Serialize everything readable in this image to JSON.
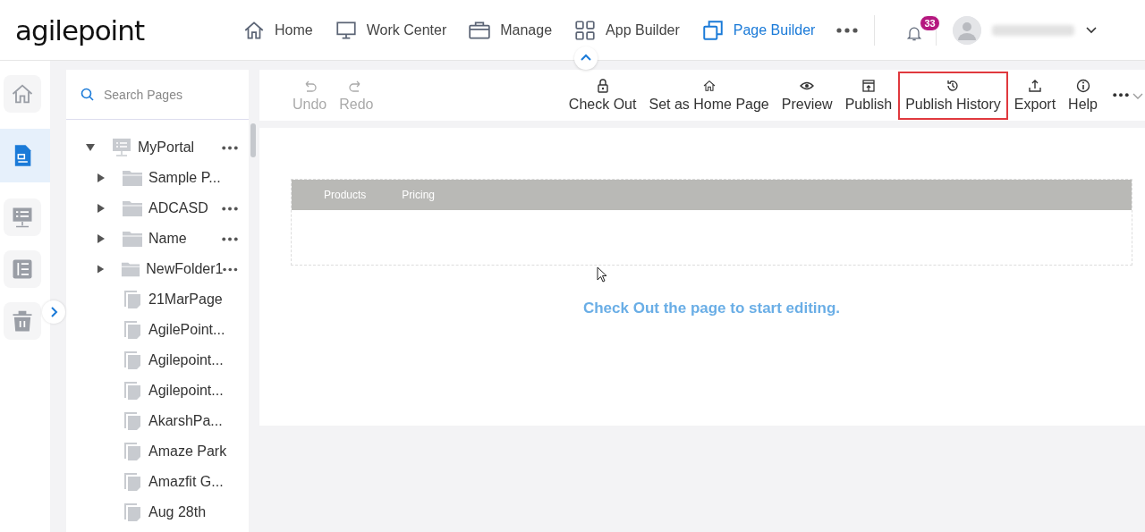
{
  "header": {
    "logo": "agilepoint",
    "nav": [
      {
        "label": "Home",
        "selected": false
      },
      {
        "label": "Work Center",
        "selected": false
      },
      {
        "label": "Manage",
        "selected": false
      },
      {
        "label": "App Builder",
        "selected": false
      },
      {
        "label": "Page Builder",
        "selected": true
      }
    ],
    "notifications": "33"
  },
  "rail": [
    {
      "selected": false
    },
    {
      "selected": true
    },
    {
      "selected": false
    },
    {
      "selected": false
    },
    {
      "selected": false
    }
  ],
  "tree": {
    "search": {
      "placeholder": "Search Pages"
    },
    "items": [
      {
        "label": "MyPortal",
        "kind": "portal",
        "expanded": true,
        "has_menu": true,
        "children": [
          {
            "label": "Sample P...",
            "kind": "folder",
            "expanded": false,
            "has_menu": false
          },
          {
            "label": "ADCASD",
            "kind": "folder",
            "expanded": false,
            "has_menu": true
          },
          {
            "label": "Name",
            "kind": "folder",
            "expanded": false,
            "has_menu": true
          },
          {
            "label": "NewFolder1",
            "kind": "folder",
            "expanded": false,
            "has_menu": true
          },
          {
            "label": "21MarPage",
            "kind": "page",
            "has_menu": false
          },
          {
            "label": "AgilePoint...",
            "kind": "page",
            "has_menu": false
          },
          {
            "label": "Agilepoint...",
            "kind": "page",
            "has_menu": false
          },
          {
            "label": "Agilepoint...",
            "kind": "page",
            "has_menu": false
          },
          {
            "label": "AkarshPa...",
            "kind": "page",
            "has_menu": false
          },
          {
            "label": "Amaze Park",
            "kind": "page",
            "has_menu": false
          },
          {
            "label": "Amazfit G...",
            "kind": "page",
            "has_menu": false
          },
          {
            "label": "Aug 28th",
            "kind": "page",
            "has_menu": false
          }
        ]
      }
    ]
  },
  "toolbar": {
    "left": [
      {
        "label": "Undo",
        "disabled": true
      },
      {
        "label": "Redo",
        "disabled": true
      }
    ],
    "right": [
      {
        "label": "Check Out",
        "highlighted": false
      },
      {
        "label": "Set as Home Page",
        "highlighted": false
      },
      {
        "label": "Preview",
        "highlighted": false
      },
      {
        "label": "Publish",
        "highlighted": false
      },
      {
        "label": "Publish History",
        "highlighted": true
      },
      {
        "label": "Export",
        "highlighted": false
      },
      {
        "label": "Help",
        "highlighted": false
      }
    ]
  },
  "canvas": {
    "menu": [
      "Products",
      "Pricing"
    ],
    "message": "Check Out the page to start editing."
  }
}
